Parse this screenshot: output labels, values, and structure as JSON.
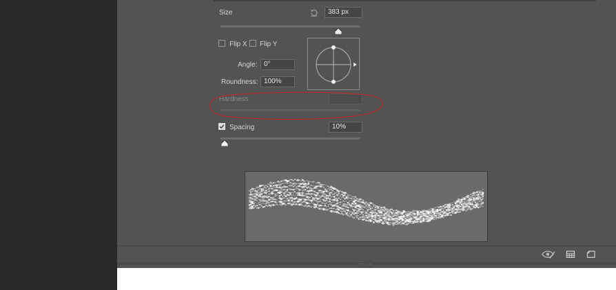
{
  "colors": {
    "panel_bg": "#535353",
    "sidebar_bg": "#282828",
    "annotation": "#c0262b",
    "field_bg": "#454545"
  },
  "size": {
    "label": "Size",
    "value": "383 px",
    "slider_fraction": 0.84,
    "reset_icon": "reset-icon"
  },
  "flip_x": {
    "label": "Flip X",
    "checked": false
  },
  "flip_y": {
    "label": "Flip Y",
    "checked": false
  },
  "angle": {
    "label": "Angle:",
    "value": "0°"
  },
  "roundness": {
    "label": "Roundness:",
    "value": "100%"
  },
  "hardness": {
    "label": "Hardness",
    "value": "",
    "disabled": true
  },
  "spacing": {
    "label": "Spacing",
    "value": "10%",
    "checked": true,
    "slider_fraction": 0.03
  },
  "footer": {
    "icons": [
      "eye-crossed-icon",
      "grid-icon",
      "new-preset-icon"
    ]
  }
}
